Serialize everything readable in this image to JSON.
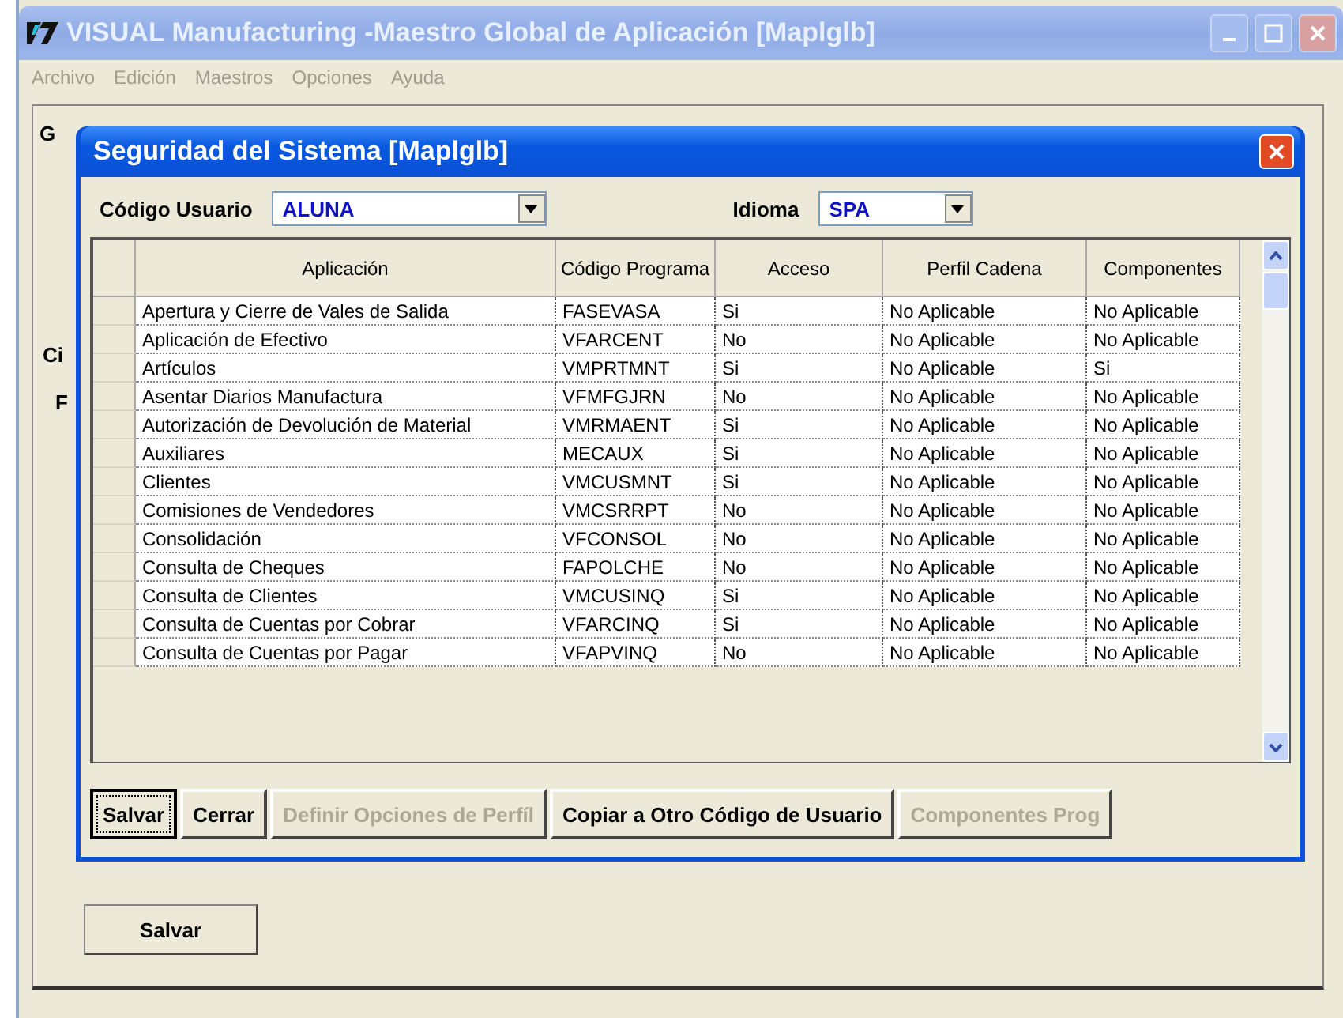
{
  "window": {
    "title": "VISUAL Manufacturing -Maestro Global de Aplicación [Maplglb]"
  },
  "menu": [
    "Archivo",
    "Edición",
    "Maestros",
    "Opciones",
    "Ayuda"
  ],
  "background_labels": [
    "G",
    "Ci",
    "F"
  ],
  "background_button": {
    "label": "Salvar"
  },
  "dialog": {
    "title": "Seguridad del Sistema [Maplglb]",
    "fields": [
      {
        "label": "Código Usuario",
        "value": "ALUNA"
      },
      {
        "label": "Idioma",
        "value": "SPA"
      }
    ],
    "table": {
      "columns": [
        "Aplicación",
        "Código Programa",
        "Acceso",
        "Perfil Cadena",
        "Componentes"
      ],
      "rows": [
        [
          "Apertura y Cierre de Vales de Salida",
          "FASEVASA",
          "Si",
          "No Aplicable",
          "No Aplicable"
        ],
        [
          "Aplicación de Efectivo",
          "VFARCENT",
          "No",
          "No Aplicable",
          "No Aplicable"
        ],
        [
          "Artículos",
          "VMPRTMNT",
          "Si",
          "No Aplicable",
          "Si"
        ],
        [
          "Asentar Diarios Manufactura",
          "VFMFGJRN",
          "No",
          "No Aplicable",
          "No Aplicable"
        ],
        [
          "Autorización de Devolución de Material",
          "VMRMAENT",
          "Si",
          "No Aplicable",
          "No Aplicable"
        ],
        [
          "Auxiliares",
          "MECAUX",
          "Si",
          "No Aplicable",
          "No Aplicable"
        ],
        [
          "Clientes",
          "VMCUSMNT",
          "Si",
          "No Aplicable",
          "No Aplicable"
        ],
        [
          "Comisiones de Vendedores",
          "VMCSRRPT",
          "No",
          "No Aplicable",
          "No Aplicable"
        ],
        [
          "Consolidación",
          "VFCONSOL",
          "No",
          "No Aplicable",
          "No Aplicable"
        ],
        [
          "Consulta de Cheques",
          "FAPOLCHE",
          "No",
          "No Aplicable",
          "No Aplicable"
        ],
        [
          "Consulta de Clientes",
          "VMCUSINQ",
          "Si",
          "No Aplicable",
          "No Aplicable"
        ],
        [
          "Consulta de Cuentas por Cobrar",
          "VFARCINQ",
          "Si",
          "No Aplicable",
          "No Aplicable"
        ],
        [
          "Consulta de Cuentas por Pagar",
          "VFAPVINQ",
          "No",
          "No Aplicable",
          "No Aplicable"
        ]
      ]
    },
    "buttons": [
      {
        "label": "Salvar",
        "disabled": false,
        "focused": true
      },
      {
        "label": "Cerrar",
        "disabled": false,
        "focused": false
      },
      {
        "label": "Definir Opciones de Perfíl",
        "disabled": true,
        "focused": false
      },
      {
        "label": "Copiar a Otro Código de Usuario",
        "disabled": false,
        "focused": false
      },
      {
        "label": "Componentes Prog",
        "disabled": true,
        "focused": false
      }
    ]
  }
}
